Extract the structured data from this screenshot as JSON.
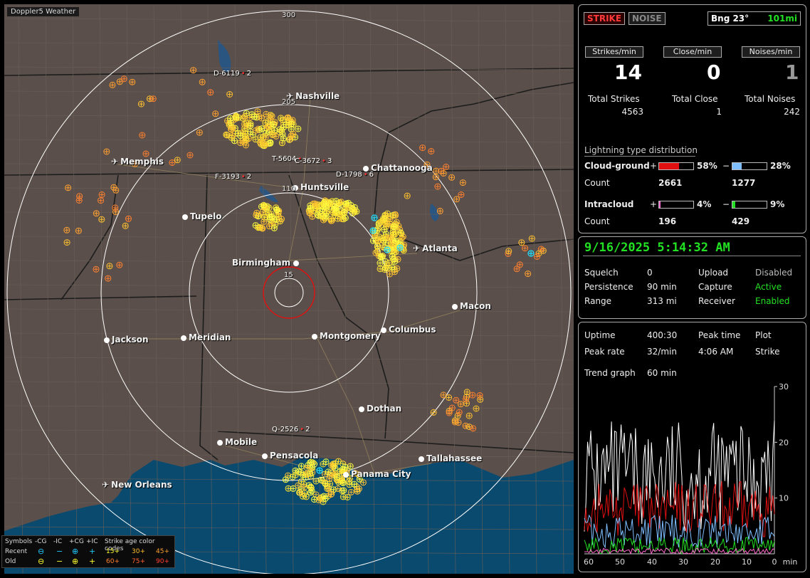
{
  "app": {
    "title": "Doppler5 Weather"
  },
  "map": {
    "cities": [
      {
        "name": "Nashville",
        "icon": "airport-icon"
      },
      {
        "name": "Memphis",
        "icon": "airport-icon"
      },
      {
        "name": "Chattanooga",
        "icon": "city-dot"
      },
      {
        "name": "Huntsville",
        "icon": "city-dot"
      },
      {
        "name": "Tupelo",
        "icon": "city-dot"
      },
      {
        "name": "Atlanta",
        "icon": "airport-icon"
      },
      {
        "name": "Birmingham",
        "icon": "city-dot"
      },
      {
        "name": "Macon",
        "icon": "city-dot"
      },
      {
        "name": "Jackson",
        "icon": "city-dot"
      },
      {
        "name": "Meridian",
        "icon": "city-dot"
      },
      {
        "name": "Montgomery",
        "icon": "city-dot"
      },
      {
        "name": "Columbus",
        "icon": "city-dot"
      },
      {
        "name": "Dothan",
        "icon": "city-dot"
      },
      {
        "name": "Mobile",
        "icon": "city-dot"
      },
      {
        "name": "Pensacola",
        "icon": "city-dot"
      },
      {
        "name": "Panama City",
        "icon": "city-dot"
      },
      {
        "name": "Tallahassee",
        "icon": "city-dot"
      },
      {
        "name": "New Orleans",
        "icon": "airport-icon"
      }
    ],
    "storm_ids": [
      "D-6119",
      "T-5604",
      "C-3672",
      "D-1798",
      "F-3193",
      "Q-2526"
    ],
    "storm_suffixes": [
      "2",
      "",
      "3",
      "6",
      "2",
      "2"
    ],
    "ring_labels": [
      "300",
      "205",
      "110",
      "15"
    ]
  },
  "legend": {
    "symbols_label": "Symbols",
    "col_headers": [
      "-CG",
      "-IC",
      "+CG",
      "+IC"
    ],
    "age_label": "Strike age color codes",
    "rows": [
      {
        "label": "Recent",
        "ages": [
          "15+",
          "30+",
          "45+"
        ]
      },
      {
        "label": "Old",
        "ages": [
          "60+",
          "75+",
          "90+"
        ]
      }
    ]
  },
  "top_panel": {
    "strike_button": "STRIKE",
    "noise_button": "NOISE",
    "bearing": "Bng 23°",
    "distance": "101mi",
    "rate_headers": [
      "Strikes/min",
      "Close/min",
      "Noises/min"
    ],
    "rates": [
      "14",
      "0",
      "1"
    ],
    "total_labels": [
      "Total Strikes",
      "Total Close",
      "Total Noises"
    ],
    "totals": [
      "4563",
      "1",
      "242"
    ],
    "dist_title": "Lightning type distribution",
    "cg_label": "Cloud-ground",
    "ic_label": "Intracloud",
    "count_label": "Count",
    "plus": "+",
    "minus": "−",
    "cg_pos_pct": "58%",
    "cg_neg_pct": "28%",
    "ic_pos_pct": "4%",
    "ic_neg_pct": "9%",
    "cg_pos_count": "2661",
    "cg_neg_count": "1277",
    "ic_pos_count": "196",
    "ic_neg_count": "429",
    "cg_pos_fraction": 0.58,
    "cg_neg_fraction": 0.28,
    "ic_pos_fraction": 0.04,
    "ic_neg_fraction": 0.09
  },
  "status_panel": {
    "datetime": "9/16/2025 5:14:32 AM",
    "squelch_label": "Squelch",
    "squelch": "0",
    "persistence_label": "Persistence",
    "persistence": "90 min",
    "range_label": "Range",
    "range": "313 mi",
    "upload_label": "Upload",
    "upload": "Disabled",
    "capture_label": "Capture",
    "capture": "Active",
    "receiver_label": "Receiver",
    "receiver": "Enabled"
  },
  "trend_panel": {
    "uptime_label": "Uptime",
    "uptime": "400:30",
    "peak_time_label": "Peak time",
    "peak_time": "4:06 AM",
    "plot_label": "Plot",
    "plot": "Strike",
    "peak_rate_label": "Peak rate",
    "peak_rate": "32/min",
    "trend_label": "Trend graph",
    "trend": "60 min",
    "y_ticks": [
      "30",
      "20",
      "10"
    ],
    "x_ticks": [
      "60",
      "50",
      "40",
      "30",
      "20",
      "10",
      "0",
      "min"
    ]
  },
  "colors": {
    "map_land": "#5a4f4a",
    "water": "#0a4a6e",
    "ring": "#ffffff",
    "accent_green": "#22e022",
    "strike_red": "#ff3b3b"
  }
}
